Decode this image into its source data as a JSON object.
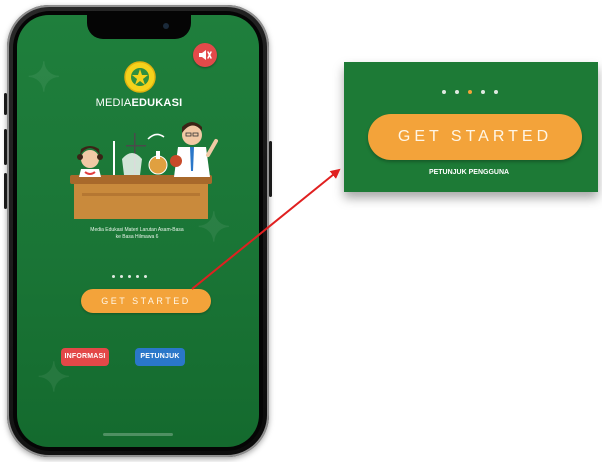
{
  "app": {
    "title_part1": "MEDIA",
    "title_part2": "EDUKASI",
    "caption_line1": "Media Edukasi Materi Larutan Asam-Basa",
    "caption_line2": "ke Basa Hilmawa 6",
    "get_started_label": "GET STARTED",
    "informasi_label": "INFORMASI",
    "petunjuk_label": "PETUNJUK",
    "pagination": {
      "total": 5,
      "active_index": 2
    }
  },
  "zoom": {
    "get_started_label": "GET STARTED",
    "petunjuk_pengguna_label": "PETUNJUK PENGGUNA"
  },
  "colors": {
    "screen_green": "#1f7f3c",
    "button_orange": "#f3a33a",
    "info_red": "#e34848",
    "petunjuk_blue": "#2a77c9",
    "arrow_red": "#e02020"
  },
  "icons": {
    "speaker": "speaker-mute-icon",
    "logo": "emblem-logo"
  }
}
